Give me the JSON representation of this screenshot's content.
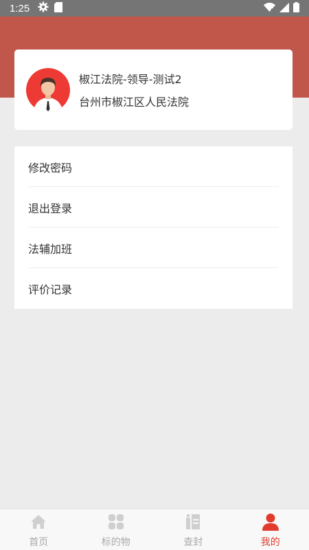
{
  "status_bar": {
    "time": "1:25"
  },
  "profile": {
    "name": "椒江法院-领导-测试2",
    "organization": "台州市椒江区人民法院"
  },
  "menu": {
    "items": [
      {
        "label": "修改密码"
      },
      {
        "label": "退出登录"
      },
      {
        "label": "法辅加班"
      },
      {
        "label": "评价记录"
      }
    ]
  },
  "bottom_nav": {
    "items": [
      {
        "label": "首页",
        "icon": "home-icon"
      },
      {
        "label": "标的物",
        "icon": "grid-icon"
      },
      {
        "label": "查封",
        "icon": "seal-icon"
      },
      {
        "label": "我的",
        "icon": "person-icon"
      }
    ],
    "active_index": 3
  },
  "colors": {
    "header": "#c0574a",
    "accent": "#e23b2e",
    "avatar_bg": "#ee3a35",
    "status_bar": "#757575"
  }
}
